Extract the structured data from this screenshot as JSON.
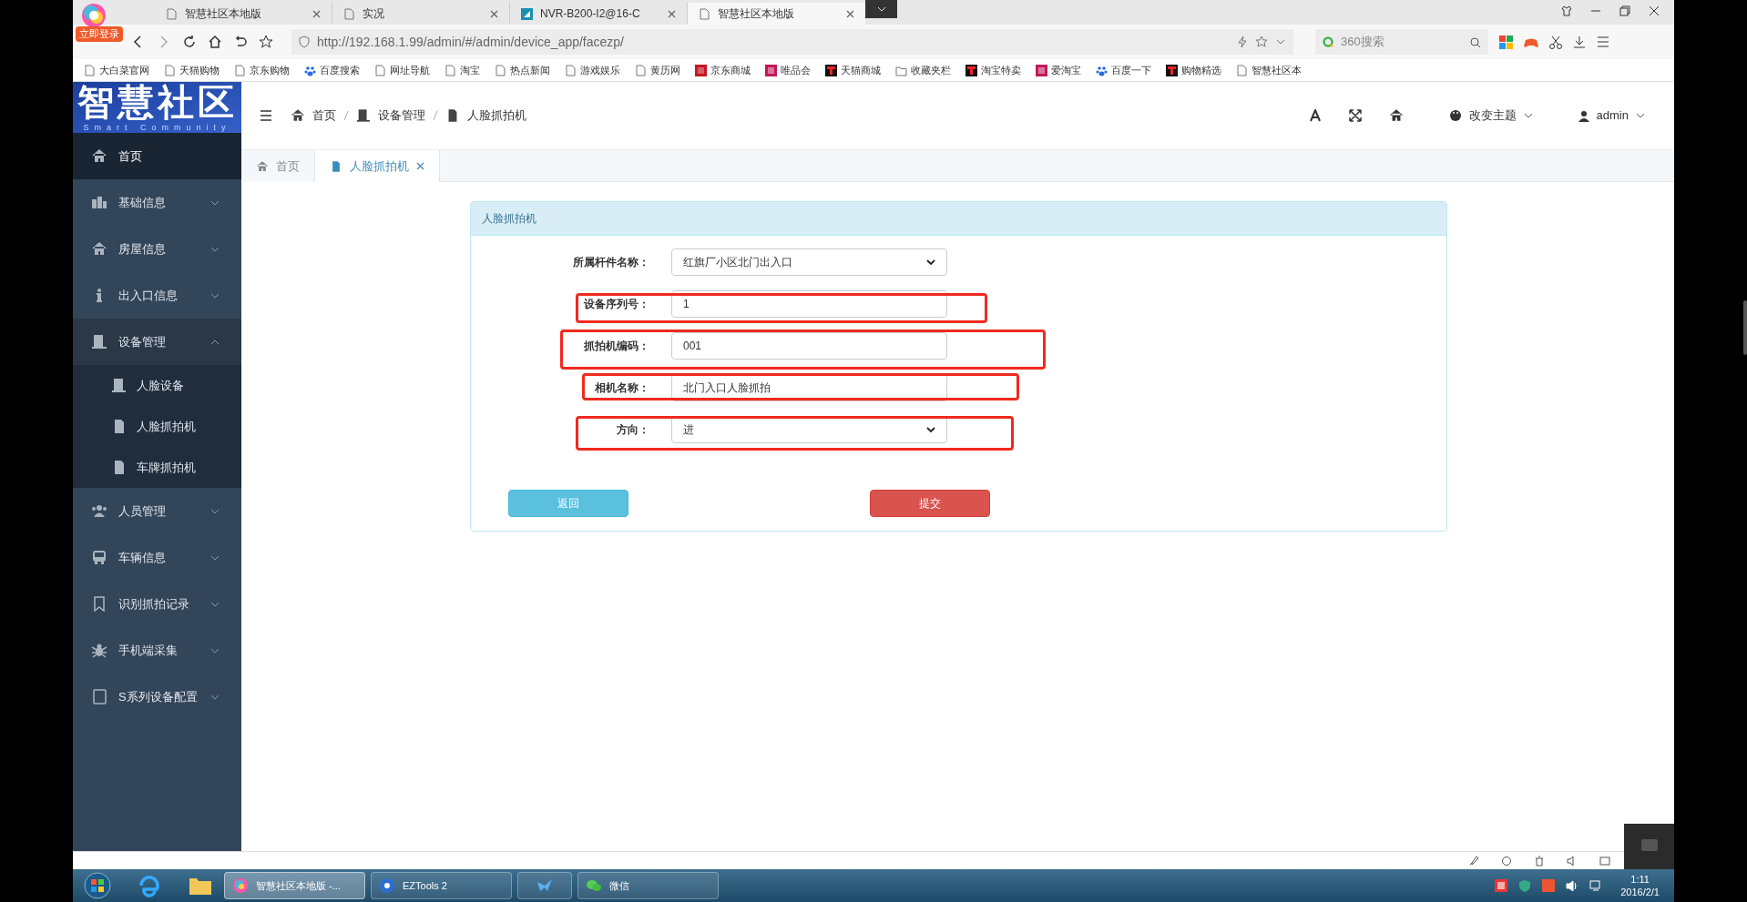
{
  "browser": {
    "login_badge": "立即登录",
    "tabs": [
      {
        "title": "智慧社区本地版",
        "kind": "page",
        "selected": false
      },
      {
        "title": "实况",
        "kind": "page",
        "selected": false
      },
      {
        "title": "NVR-B200-I2@16-C",
        "kind": "nvr",
        "selected": false
      },
      {
        "title": "智慧社区本地版",
        "kind": "page",
        "selected": true
      }
    ],
    "url": "http://192.168.1.99/admin/#/admin/device_app/facezp/",
    "search_placeholder": "360搜索",
    "bookmarks": [
      {
        "label": "大白菜官网",
        "kind": "page"
      },
      {
        "label": "天猫购物",
        "kind": "page"
      },
      {
        "label": "京东购物",
        "kind": "page"
      },
      {
        "label": "百度搜索",
        "kind": "paw"
      },
      {
        "label": "网址导航",
        "kind": "page"
      },
      {
        "label": "淘宝",
        "kind": "page"
      },
      {
        "label": "热点新闻",
        "kind": "page"
      },
      {
        "label": "游戏娱乐",
        "kind": "page"
      },
      {
        "label": "黄历网",
        "kind": "page"
      },
      {
        "label": "京东商城",
        "kind": "jd"
      },
      {
        "label": "唯品会",
        "kind": "vip"
      },
      {
        "label": "天猫商城",
        "kind": "tmall"
      },
      {
        "label": "收藏夹栏",
        "kind": "folder"
      },
      {
        "label": "淘宝特卖",
        "kind": "tmall"
      },
      {
        "label": "爱淘宝",
        "kind": "vip"
      },
      {
        "label": "百度一下",
        "kind": "paw"
      },
      {
        "label": "购物精选",
        "kind": "tmall"
      },
      {
        "label": "智慧社区本",
        "kind": "page"
      }
    ]
  },
  "app": {
    "logo": {
      "title": "智慧社区",
      "subtitle": "Smart Community"
    },
    "breadcrumb": [
      "首页",
      "设备管理",
      "人脸抓拍机"
    ],
    "header_actions": {
      "theme": "改变主题",
      "user": "admin"
    },
    "sidebar": [
      {
        "label": "首页",
        "selected": true
      },
      {
        "label": "基础信息",
        "selected": false
      },
      {
        "label": "房屋信息",
        "selected": false
      },
      {
        "label": "出入口信息",
        "selected": false
      },
      {
        "label": "设备管理",
        "selected": false,
        "expanded": true,
        "children": [
          {
            "label": "人脸设备"
          },
          {
            "label": "人脸抓拍机"
          },
          {
            "label": "车牌抓拍机"
          }
        ]
      },
      {
        "label": "人员管理",
        "selected": false
      },
      {
        "label": "车辆信息",
        "selected": false
      },
      {
        "label": "识别抓拍记录",
        "selected": false
      },
      {
        "label": "手机端采集",
        "selected": false
      },
      {
        "label": "S系列设备配置",
        "selected": false
      }
    ],
    "page_tabs": [
      {
        "label": "首页",
        "selected": false
      },
      {
        "label": "人脸抓拍机",
        "selected": true
      }
    ],
    "panel_title": "人脸抓拍机",
    "form": [
      {
        "label": "所属杆件名称：",
        "kind": "select",
        "value": "红旗厂小区北门出入口"
      },
      {
        "label": "设备序列号：",
        "kind": "input",
        "value": "1",
        "highlighted": true
      },
      {
        "label": "抓拍机编码：",
        "kind": "input",
        "value": "001",
        "highlighted": true
      },
      {
        "label": "相机名称：",
        "kind": "input",
        "value": "北门入口人脸抓拍",
        "highlighted": true
      },
      {
        "label": "方向：",
        "kind": "select",
        "value": "进",
        "highlighted": true
      }
    ],
    "buttons": [
      {
        "label": "返回",
        "kind": "back"
      },
      {
        "label": "提交",
        "kind": "submit"
      }
    ]
  },
  "taskbar": {
    "tasks": [
      {
        "label": "智慧社区本地版 -...",
        "selected": true
      },
      {
        "label": "EZTools 2",
        "selected": false
      },
      {
        "selected": false
      },
      {
        "label": "微信",
        "selected": false
      }
    ],
    "time": "1:11",
    "date": "2016/2/1"
  }
}
